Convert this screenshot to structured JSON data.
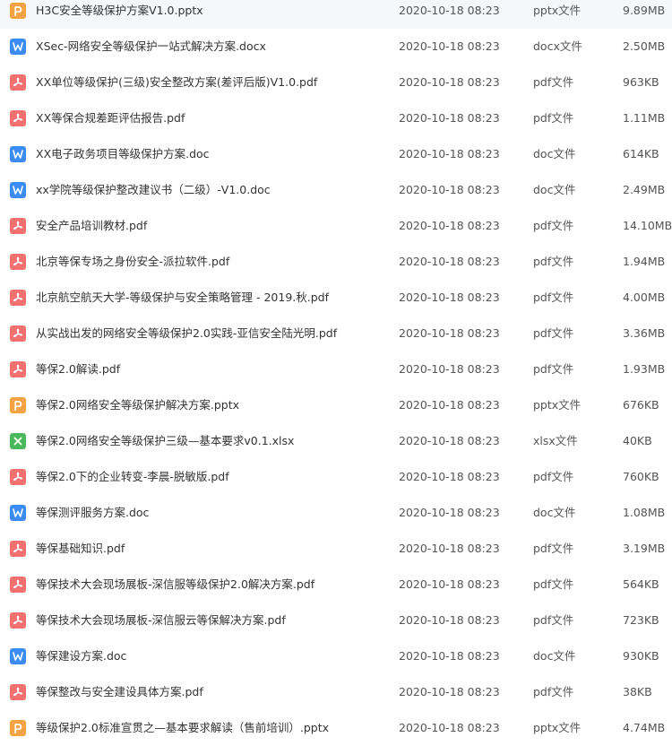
{
  "colors": {
    "pptx": "#f5a342",
    "docx": "#3d8bf5",
    "doc": "#3d8bf5",
    "pdf": "#f2706e",
    "xlsx": "#4cb85e"
  },
  "files": [
    {
      "name": "H3C安全等级保护方案V1.0.pptx",
      "date": "2020-10-18 08:23",
      "type": "pptx文件",
      "size": "9.89MB",
      "kind": "pptx",
      "icon": "pptx-file-icon"
    },
    {
      "name": "XSec-网络安全等级保护一站式解决方案.docx",
      "date": "2020-10-18 08:23",
      "type": "docx文件",
      "size": "2.50MB",
      "kind": "docx",
      "icon": "word-file-icon"
    },
    {
      "name": "XX单位等级保护(三级)安全整改方案(差评后版)V1.0.pdf",
      "date": "2020-10-18 08:23",
      "type": "pdf文件",
      "size": "963KB",
      "kind": "pdf",
      "icon": "pdf-file-icon"
    },
    {
      "name": "XX等保合规差距评估报告.pdf",
      "date": "2020-10-18 08:23",
      "type": "pdf文件",
      "size": "1.11MB",
      "kind": "pdf",
      "icon": "pdf-file-icon"
    },
    {
      "name": "XX电子政务项目等级保护方案.doc",
      "date": "2020-10-18 08:23",
      "type": "doc文件",
      "size": "614KB",
      "kind": "doc",
      "icon": "word-file-icon"
    },
    {
      "name": "xx学院等级保护整改建议书（二级）-V1.0.doc",
      "date": "2020-10-18 08:23",
      "type": "doc文件",
      "size": "2.49MB",
      "kind": "doc",
      "icon": "word-file-icon"
    },
    {
      "name": "安全产品培训教材.pdf",
      "date": "2020-10-18 08:23",
      "type": "pdf文件",
      "size": "14.10MB",
      "kind": "pdf",
      "icon": "pdf-file-icon"
    },
    {
      "name": "北京等保专场之身份安全-派拉软件.pdf",
      "date": "2020-10-18 08:23",
      "type": "pdf文件",
      "size": "1.94MB",
      "kind": "pdf",
      "icon": "pdf-file-icon"
    },
    {
      "name": "北京航空航天大学-等级保护与安全策略管理 - 2019.秋.pdf",
      "date": "2020-10-18 08:23",
      "type": "pdf文件",
      "size": "4.00MB",
      "kind": "pdf",
      "icon": "pdf-file-icon"
    },
    {
      "name": "从实战出发的网络安全等级保护2.0实践-亚信安全陆光明.pdf",
      "date": "2020-10-18 08:23",
      "type": "pdf文件",
      "size": "3.36MB",
      "kind": "pdf",
      "icon": "pdf-file-icon"
    },
    {
      "name": "等保2.0解读.pdf",
      "date": "2020-10-18 08:23",
      "type": "pdf文件",
      "size": "1.93MB",
      "kind": "pdf",
      "icon": "pdf-file-icon"
    },
    {
      "name": "等保2.0网络安全等级保护解决方案.pptx",
      "date": "2020-10-18 08:23",
      "type": "pptx文件",
      "size": "676KB",
      "kind": "pptx",
      "icon": "pptx-file-icon"
    },
    {
      "name": "等保2.0网络安全等级保护三级—基本要求v0.1.xlsx",
      "date": "2020-10-18 08:23",
      "type": "xlsx文件",
      "size": "40KB",
      "kind": "xlsx",
      "icon": "excel-file-icon"
    },
    {
      "name": "等保2.0下的企业转变-李晨-脱敏版.pdf",
      "date": "2020-10-18 08:23",
      "type": "pdf文件",
      "size": "760KB",
      "kind": "pdf",
      "icon": "pdf-file-icon"
    },
    {
      "name": "等保测评服务方案.doc",
      "date": "2020-10-18 08:23",
      "type": "doc文件",
      "size": "1.08MB",
      "kind": "doc",
      "icon": "word-file-icon"
    },
    {
      "name": "等保基础知识.pdf",
      "date": "2020-10-18 08:23",
      "type": "pdf文件",
      "size": "3.19MB",
      "kind": "pdf",
      "icon": "pdf-file-icon"
    },
    {
      "name": "等保技术大会现场展板-深信服等级保护2.0解决方案.pdf",
      "date": "2020-10-18 08:23",
      "type": "pdf文件",
      "size": "564KB",
      "kind": "pdf",
      "icon": "pdf-file-icon"
    },
    {
      "name": "等保技术大会现场展板-深信服云等保解决方案.pdf",
      "date": "2020-10-18 08:23",
      "type": "pdf文件",
      "size": "723KB",
      "kind": "pdf",
      "icon": "pdf-file-icon"
    },
    {
      "name": "等保建设方案.doc",
      "date": "2020-10-18 08:23",
      "type": "doc文件",
      "size": "930KB",
      "kind": "doc",
      "icon": "word-file-icon"
    },
    {
      "name": "等保整改与安全建设具体方案.pdf",
      "date": "2020-10-18 08:23",
      "type": "pdf文件",
      "size": "38KB",
      "kind": "pdf",
      "icon": "pdf-file-icon"
    },
    {
      "name": "等级保护2.0标准宣贯之—基本要求解读（售前培训）.pptx",
      "date": "2020-10-18 08:23",
      "type": "pptx文件",
      "size": "4.74MB",
      "kind": "pptx",
      "icon": "pptx-file-icon"
    }
  ]
}
